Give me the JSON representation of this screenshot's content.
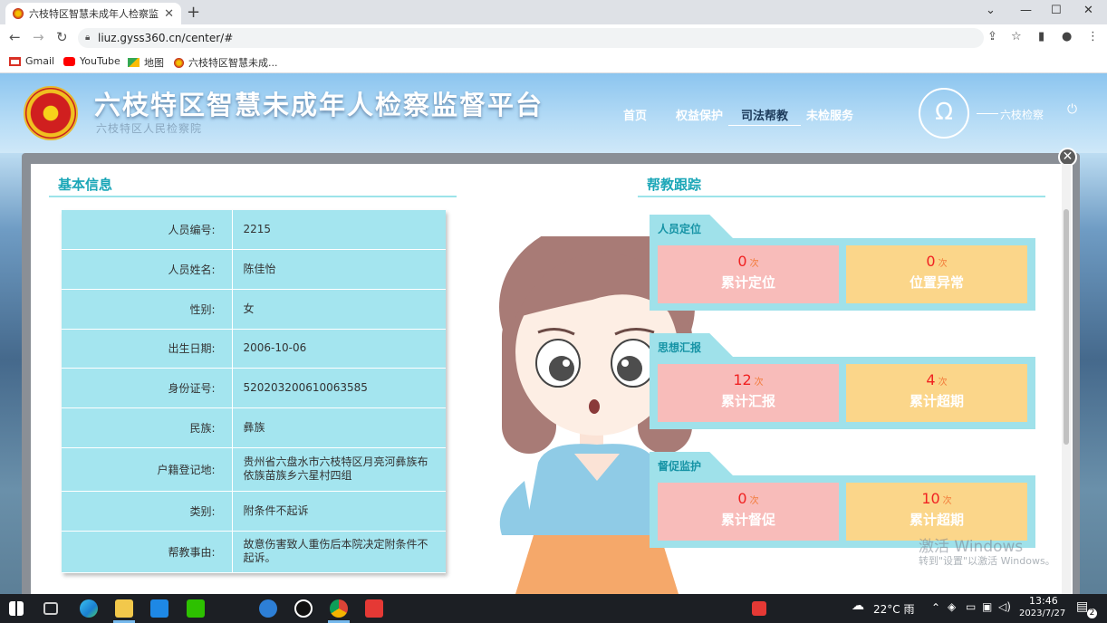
{
  "browser": {
    "tab_title": "六枝特区智慧未成年人检察监督",
    "url": "liuz.gyss360.cn/center/#",
    "bookmarks": [
      {
        "label": "Gmail",
        "icon": "gmail-icon",
        "color": "#d93025"
      },
      {
        "label": "YouTube",
        "icon": "youtube-icon",
        "color": "#ff0000"
      },
      {
        "label": "地图",
        "icon": "maps-icon",
        "color": "#34a853"
      },
      {
        "label": "六枝特区智慧未成...",
        "icon": "emblem-icon",
        "color": "#c02020"
      }
    ]
  },
  "site": {
    "title": "六枝特区智慧未成年人检察监督平台",
    "subtitle": "六枝特区人民检察院",
    "nav": [
      "首页",
      "权益保护",
      "司法帮教",
      "未检服务"
    ],
    "active_nav": 2,
    "user": "六枝检察"
  },
  "basic_info": {
    "title": "基本信息",
    "rows": [
      {
        "label": "人员编号:",
        "value": "2215"
      },
      {
        "label": "人员姓名:",
        "value": "陈佳怡"
      },
      {
        "label": "性别:",
        "value": "女"
      },
      {
        "label": "出生日期:",
        "value": "2006-10-06"
      },
      {
        "label": "身份证号:",
        "value": "520203200610063585"
      },
      {
        "label": "民族:",
        "value": "彝族"
      },
      {
        "label": "户籍登记地:",
        "value": "贵州省六盘水市六枝特区月亮河彝族布依族苗族乡六星村四组"
      },
      {
        "label": "类别:",
        "value": "附条件不起诉"
      },
      {
        "label": "帮教事由:",
        "value": "故意伤害致人重伤后本院决定附条件不起诉。"
      }
    ]
  },
  "tracking": {
    "title": "帮教跟踪",
    "groups": [
      {
        "title": "人员定位",
        "stats": [
          {
            "value": "0",
            "unit": "次",
            "label": "累计定位"
          },
          {
            "value": "0",
            "unit": "次",
            "label": "位置异常"
          }
        ]
      },
      {
        "title": "思想汇报",
        "stats": [
          {
            "value": "12",
            "unit": "次",
            "label": "累计汇报"
          },
          {
            "value": "4",
            "unit": "次",
            "label": "累计超期"
          }
        ]
      },
      {
        "title": "督促监护",
        "stats": [
          {
            "value": "0",
            "unit": "次",
            "label": "累计督促"
          },
          {
            "value": "10",
            "unit": "次",
            "label": "累计超期"
          }
        ]
      }
    ]
  },
  "watermark": {
    "line1": "激活 Windows",
    "line2": "转到\"设置\"以激活 Windows。"
  },
  "taskbar": {
    "weather": "22°C 雨",
    "time": "13:46",
    "date": "2023/7/27",
    "notifications": "2"
  }
}
